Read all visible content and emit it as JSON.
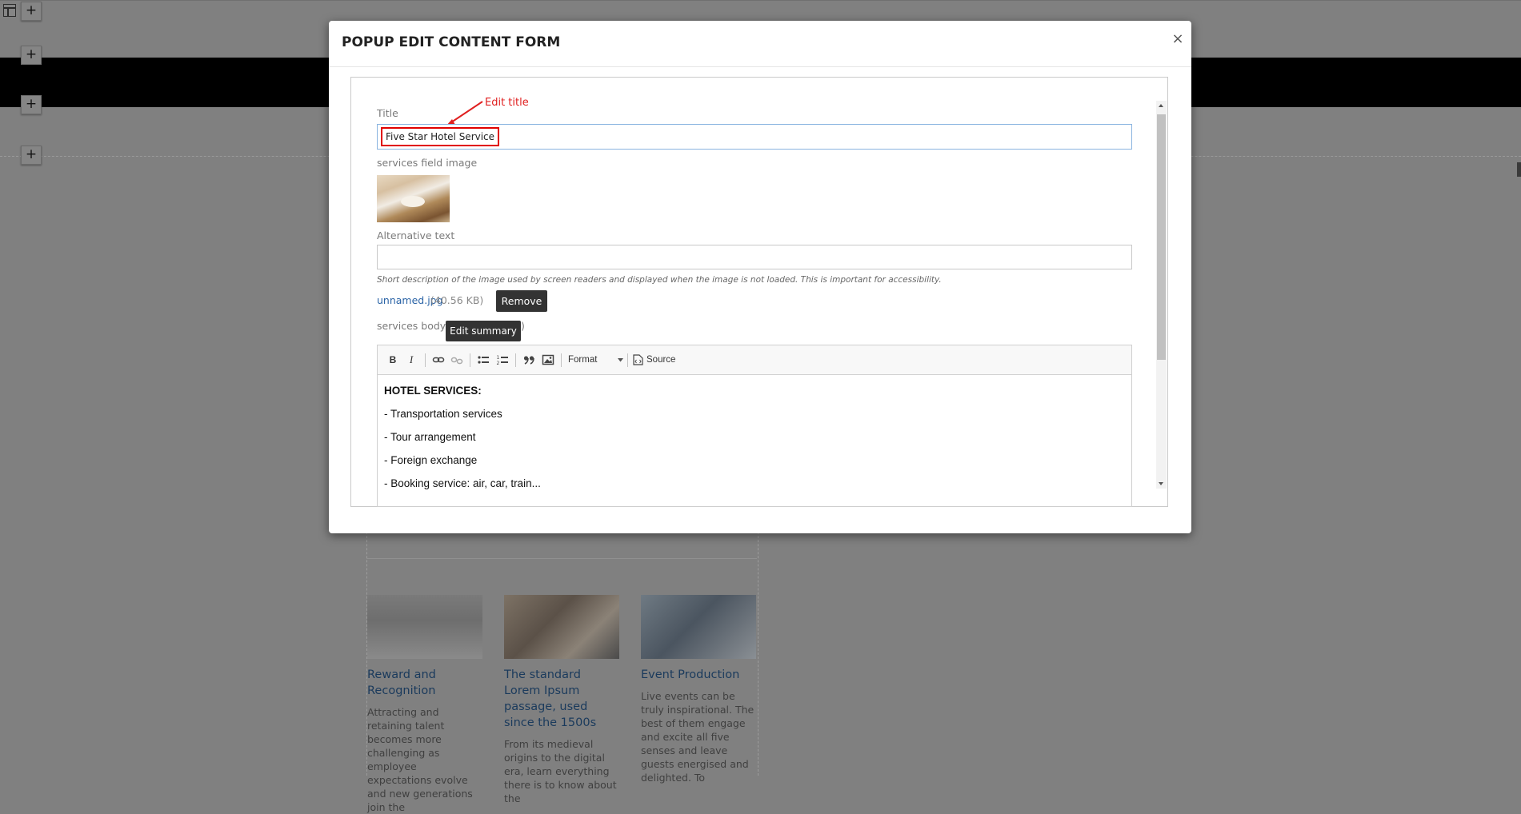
{
  "modal": {
    "title": "POPUP EDIT CONTENT FORM",
    "close_label": "×"
  },
  "form": {
    "title_label": "Title",
    "title_value": "Five Star Hotel Service",
    "annotation": "Edit title",
    "image_label": "services field image",
    "alt_label": "Alternative text",
    "alt_value": "",
    "alt_help": "Short description of the image used by screen readers and displayed when the image is not loaded. This is important for accessibility.",
    "file_name": "unnamed.jpg",
    "file_size": "(40.56 KB)",
    "remove_label": "Remove",
    "body_label": "services body (",
    "body_label_close": ")",
    "edit_summary_label": "Edit summary"
  },
  "toolbar": {
    "bold": "B",
    "italic": "I",
    "format_label": "Format",
    "source_label": "Source"
  },
  "editor": {
    "lines": [
      "HOTEL SERVICES:",
      "- Transportation services",
      "- Tour arrangement",
      "- Foreign exchange",
      "- Booking service: air, car, train..."
    ]
  },
  "background": {
    "plus_label": "+",
    "cards": [
      {
        "title": "Reward and Recognition",
        "text": "Attracting and retaining talent becomes more challenging as employee expectations evolve and new generations join the"
      },
      {
        "title": "The standard Lorem Ipsum passage, used since the 1500s",
        "text": "From its medieval origins to the digital era, learn everything there is to know about the"
      },
      {
        "title": "Event Production",
        "text": "Live events can be truly inspirational. The best of them engage and excite all five senses and leave guests energised and delighted. To"
      }
    ]
  }
}
